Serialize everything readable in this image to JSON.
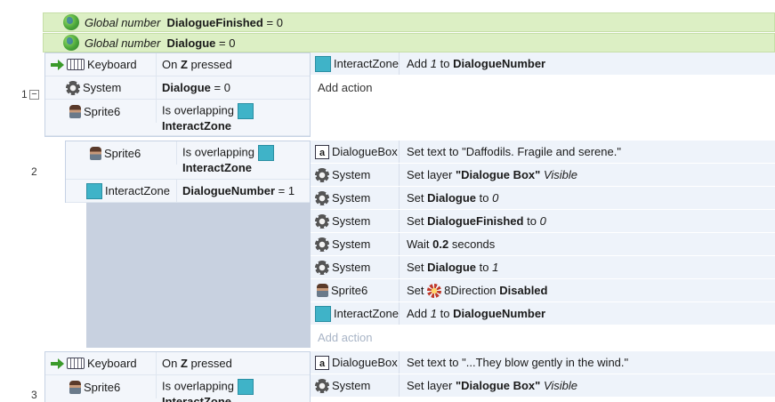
{
  "globals": [
    {
      "prefix": "Global number",
      "name": "DialogueFinished",
      "value": "= 0"
    },
    {
      "prefix": "Global number",
      "name": "Dialogue",
      "value": "= 0"
    }
  ],
  "events": {
    "e1": {
      "number": "1",
      "collapse": "−",
      "conditions": [
        {
          "object": "Keyboard",
          "pre": "On",
          "bold": "Z",
          "post": "pressed"
        },
        {
          "object": "System",
          "bold": "Dialogue",
          "post": "= 0"
        },
        {
          "object": "Sprite6",
          "pre": "Is overlapping",
          "bold2": "InteractZone"
        }
      ],
      "actions": [
        {
          "object": "InteractZone",
          "pre": "Add",
          "italic": "1",
          "mid": "to",
          "bold": "DialogueNumber"
        }
      ],
      "add_action": "Add action"
    },
    "e2": {
      "number": "2",
      "conditions": [
        {
          "object": "Sprite6",
          "pre": "Is overlapping",
          "bold2": "InteractZone"
        },
        {
          "object": "InteractZone",
          "bold": "DialogueNumber",
          "post": "= 1"
        }
      ],
      "actions": [
        {
          "object": "DialogueBox",
          "text": "Set text to \"Daffodils. Fragile and serene.\""
        },
        {
          "object": "System",
          "pre": "Set layer",
          "bold": "\"Dialogue Box\"",
          "italic": "Visible"
        },
        {
          "object": "System",
          "pre": "Set",
          "bold": "Dialogue",
          "mid": "to",
          "italic": "0"
        },
        {
          "object": "System",
          "pre": "Set",
          "bold": "DialogueFinished",
          "mid": "to",
          "italic": "0"
        },
        {
          "object": "System",
          "pre": "Wait",
          "bold": "0.2",
          "post": "seconds"
        },
        {
          "object": "System",
          "pre": "Set",
          "bold": "Dialogue",
          "mid": "to",
          "italic": "1"
        },
        {
          "object": "Sprite6",
          "pre": "Set",
          "behavior": "8Direction",
          "bold": "Disabled"
        },
        {
          "object": "InteractZone",
          "pre": "Add",
          "italic": "1",
          "mid": "to",
          "bold": "DialogueNumber"
        }
      ],
      "add_action": "Add action"
    },
    "e3": {
      "number": "3",
      "conditions": [
        {
          "object": "Keyboard",
          "pre": "On",
          "bold": "Z",
          "post": "pressed"
        },
        {
          "object": "Sprite6",
          "pre": "Is overlapping",
          "bold2": "InteractZone"
        }
      ],
      "actions": [
        {
          "object": "DialogueBox",
          "text": "Set text to \"...They blow gently in the wind.\""
        },
        {
          "object": "System",
          "pre": "Set layer",
          "bold": "\"Dialogue Box\"",
          "italic": "Visible"
        }
      ]
    }
  },
  "colors": {
    "global_row": "#dcefc4",
    "condition_bg": "#f3f6fb",
    "action_bg": "#eef3fa",
    "interactzone_icon": "#3fb3c8",
    "subevent_fill": "#c8d1e0"
  }
}
